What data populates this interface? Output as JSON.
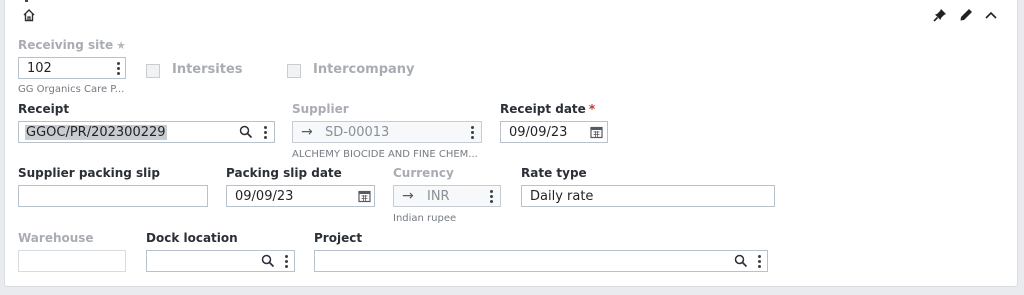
{
  "header": {
    "home_icon": "home-icon",
    "actions": [
      "pin-icon",
      "pencil-icon",
      "chevron-up-icon"
    ]
  },
  "receiving_site": {
    "label": "Receiving site",
    "optional_mark": "★",
    "value": "102",
    "description": "GG Organics Care P..."
  },
  "intersites": {
    "label": "Intersites",
    "checked": false
  },
  "intercompany": {
    "label": "Intercompany",
    "checked": false
  },
  "receipt": {
    "label": "Receipt",
    "value": "GGOC/PR/202300229"
  },
  "supplier": {
    "label": "Supplier",
    "value": "SD-00013",
    "description": "ALCHEMY BIOCIDE AND FINE CHEM..."
  },
  "receipt_date": {
    "label": "Receipt date",
    "required_mark": "*",
    "value": "09/09/23"
  },
  "supplier_packing_slip": {
    "label": "Supplier packing slip",
    "value": ""
  },
  "packing_slip_date": {
    "label": "Packing slip date",
    "value": "09/09/23"
  },
  "currency": {
    "label": "Currency",
    "value": "INR",
    "description": "Indian rupee"
  },
  "rate_type": {
    "label": "Rate type",
    "value": "Daily rate"
  },
  "warehouse": {
    "label": "Warehouse",
    "value": ""
  },
  "dock_location": {
    "label": "Dock location",
    "value": ""
  },
  "project": {
    "label": "Project",
    "value": ""
  },
  "colors": {
    "border": "#b7c2cc",
    "label": "#2b2f36",
    "disabled_label": "#a9adb3",
    "required": "#c0392b",
    "selection": "#c9ccd1"
  }
}
